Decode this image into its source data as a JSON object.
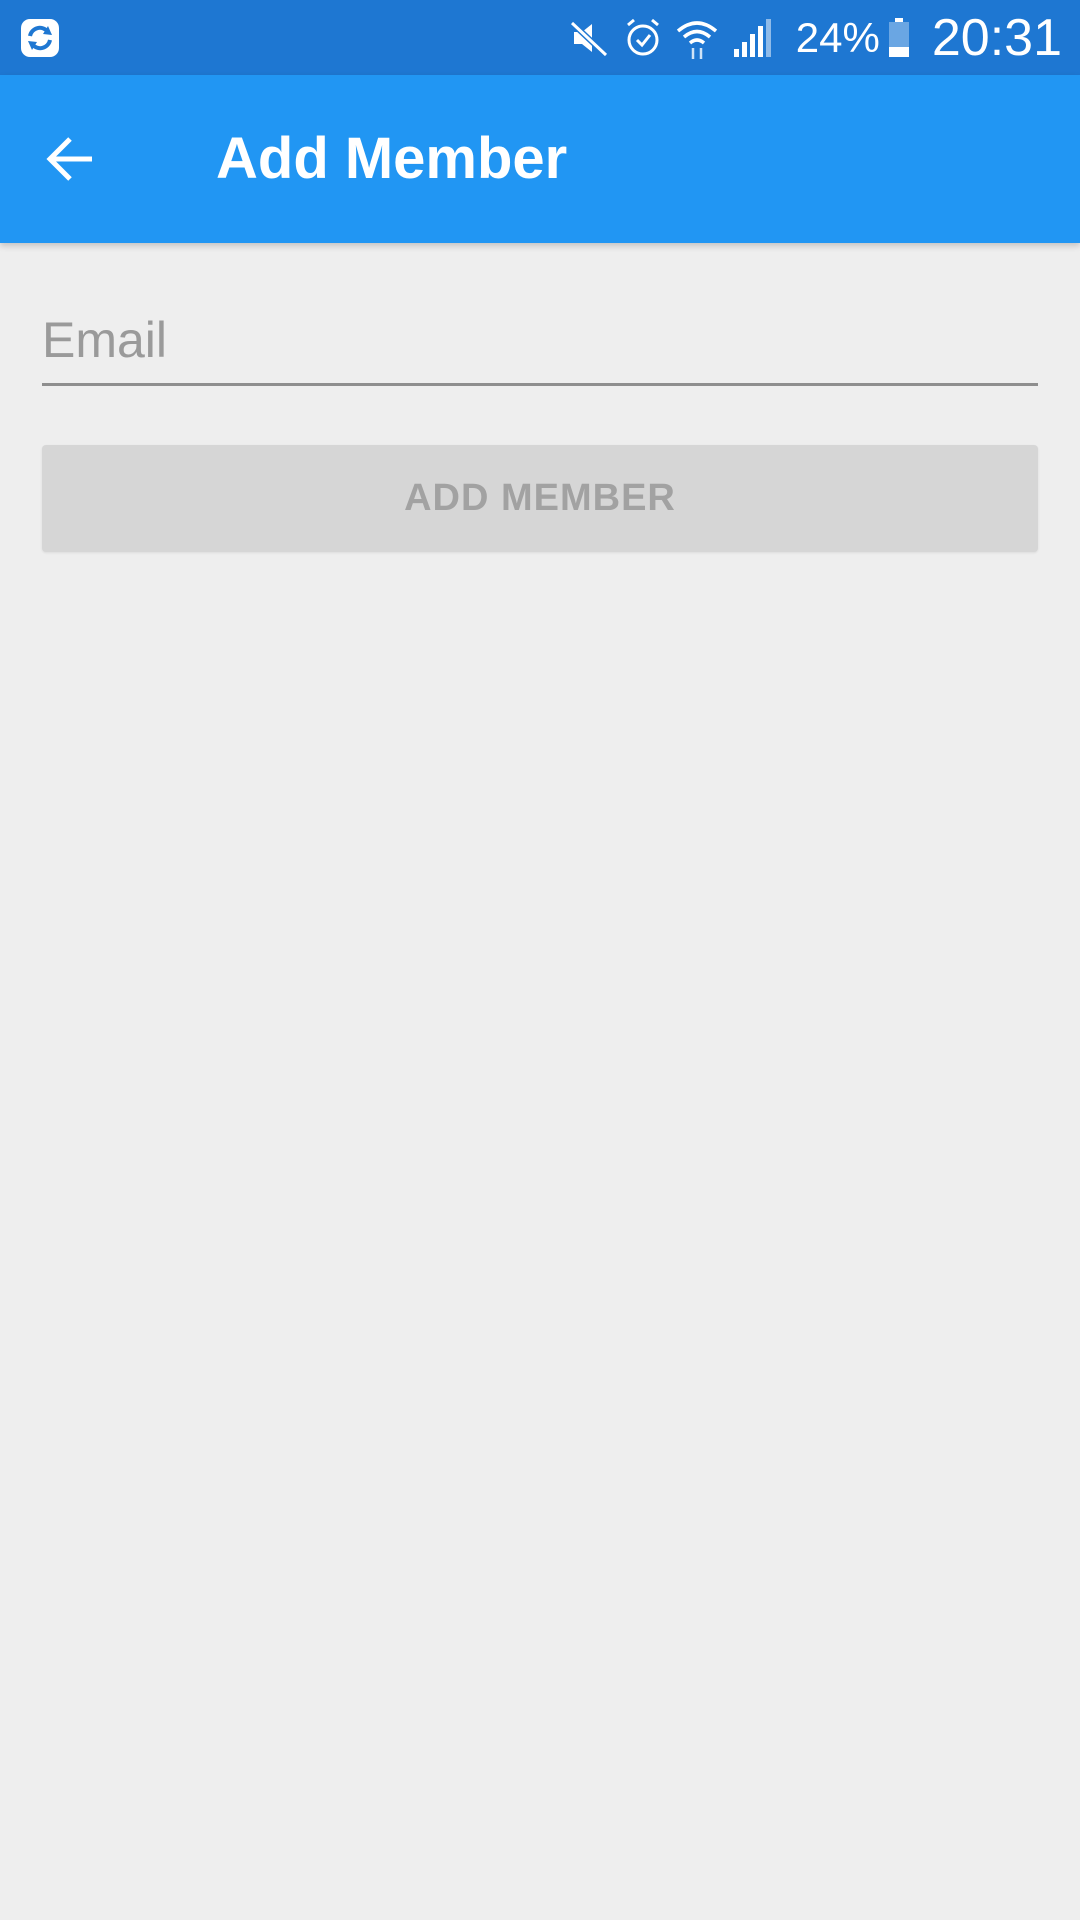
{
  "status_bar": {
    "app_icon": "sync-app-icon",
    "icons": [
      "mute-icon",
      "alarm-icon",
      "wifi-icon",
      "signal-icon"
    ],
    "battery_percent": "24%",
    "battery_icon": "battery-icon",
    "time": "20:31"
  },
  "app_bar": {
    "back_icon": "arrow-back-icon",
    "title": "Add Member",
    "color": "#2196f3"
  },
  "form": {
    "email": {
      "value": "",
      "placeholder": "Email"
    },
    "submit_label": "ADD MEMBER",
    "submit_enabled": false
  }
}
